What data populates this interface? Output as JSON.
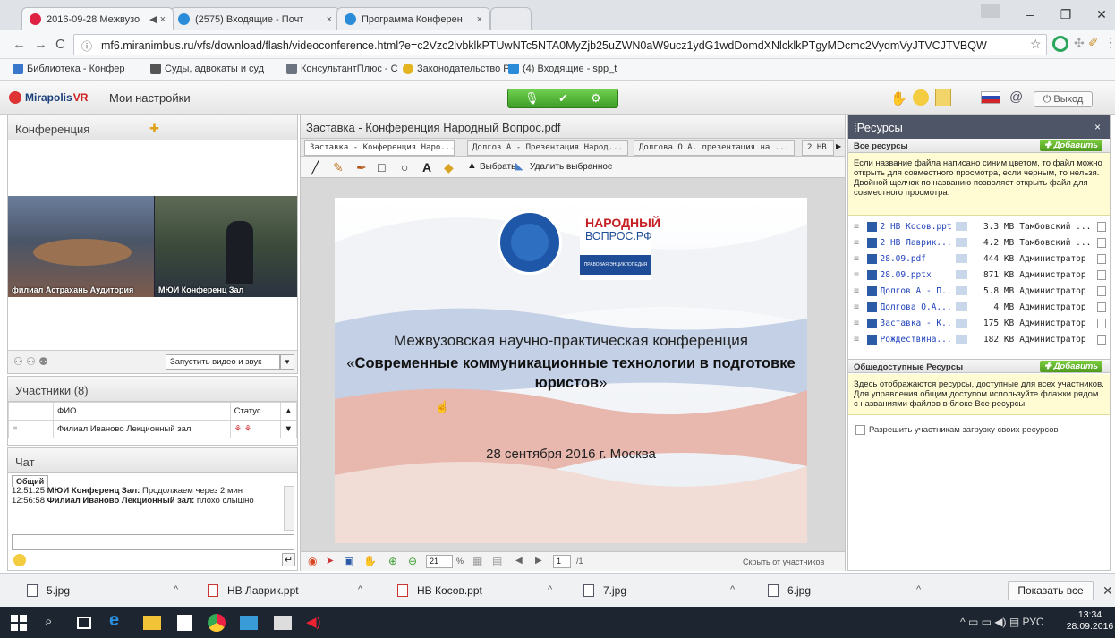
{
  "browser": {
    "tabs": [
      {
        "label": "2016-09-28 Межвузо",
        "active": true
      },
      {
        "label": "(2575) Входящие - Почт"
      },
      {
        "label": "Программа Конферен"
      }
    ],
    "url": "mf6.miranimbus.ru/vfs/download/flash/videoconference.html?e=c2Vzc2lvbklkPTUwNTc5NTA0MyZjb25uZWN0aW9ucz1ydG1wdDomdXNlcklkPTgyMDcmc2VydmVyJTVCJTVBQW",
    "bookmarks": [
      "Библиотека - Конфер",
      "Суды, адвокаты и суд",
      "КонсультантПлюс - С",
      "Законодательство Ро",
      "(4) Входящие - spp_t"
    ]
  },
  "app": {
    "logo_brand": "Mirapolis",
    "logo_suffix": "VR",
    "settings_label": "Мои настройки",
    "exit_label": "Выход"
  },
  "conference": {
    "title": "Конференция",
    "videos": [
      {
        "label": "филиал Астрахань Аудитория"
      },
      {
        "label": "МЮИ Конференц Зал"
      }
    ],
    "start_label": "Запустить видео и звук"
  },
  "participants": {
    "title": "Участники (8)",
    "col_name": "ФИО",
    "col_status": "Статус",
    "rows": [
      {
        "name": "Филиал Иваново Лекционный зал"
      }
    ]
  },
  "chat": {
    "title": "Чат",
    "tab": "Общий",
    "messages": [
      {
        "time": "12:51:25",
        "author": "МЮИ Конференц Зал:",
        "text": "Продолжаем через 2 мин"
      },
      {
        "time": "12:56:58",
        "author": "Филиал Иваново Лекционный зал:",
        "text": "плохо слышно"
      }
    ]
  },
  "presentation": {
    "title": "Заставка - Конференция Народный Вопрос.pdf",
    "doc_tabs": [
      "Заставка - Конференция Наро...",
      "Долгов А - Презентация Народ...",
      "Долгова О.А. презентация на ...",
      "2 НВ"
    ],
    "tools": {
      "select": "Выбрать",
      "delete": "Удалить выбранное"
    },
    "slide": {
      "brand_line1": "НАРОДНЫЙ",
      "brand_line2": "ВОПРОС.РФ",
      "brand_sub": "ПРАВОВАЯ ЭНЦИКЛОПЕДИЯ",
      "line1": "Межвузовская научно-практическая конференция",
      "quote_open": "«",
      "line2": "Современные коммуникационные технологии в подготовке юристов",
      "quote_close": "»",
      "date": "28 сентября 2016 г. Москва"
    },
    "zoom": "21",
    "zoom_unit": "%",
    "page": "1",
    "page_total": "/1",
    "hide_label": "Скрыть от участников"
  },
  "resources": {
    "title": "Ресурсы",
    "all_title": "Все ресурсы",
    "add_label": "Добавить",
    "info": "Если название файла написано синим цветом, то файл можно открыть для совместного просмотра, если черным, то нельзя. Двойной щелчок по названию позволяет открыть файл для совместного просмотра.",
    "files": [
      {
        "name": "2 НВ Косов.ppt",
        "size": "3.3 MB",
        "owner": "Тамбовский ..."
      },
      {
        "name": "2 НВ Лаврик...",
        "size": "4.2 MB",
        "owner": "Тамбовский ..."
      },
      {
        "name": "28.09.pdf",
        "size": "444 KB",
        "owner": "Администратор"
      },
      {
        "name": "28.09.pptx",
        "size": "871 KB",
        "owner": "Администратор"
      },
      {
        "name": "Долгов А - П...",
        "size": "5.8 MB",
        "owner": "Администратор"
      },
      {
        "name": "Долгова О.А...",
        "size": "4 MB",
        "owner": "Администратор"
      },
      {
        "name": "Заставка - К...",
        "size": "175 KB",
        "owner": "Администратор"
      },
      {
        "name": "Рождествина...",
        "size": "182 KB",
        "owner": "Администратор"
      }
    ],
    "public_title": "Общедоступные Ресурсы",
    "public_info": "Здесь отображаются ресурсы, доступные для всех участников. Для управления общим доступом используйте флажки рядом с названиями файлов в блоке Все ресурсы.",
    "allow_upload": "Разрешить участникам загрузку своих ресурсов"
  },
  "downloads": {
    "items": [
      "5.jpg",
      "НВ Лаврик.ppt",
      "НВ Косов.ppt",
      "7.jpg",
      "6.jpg"
    ],
    "show_all": "Показать все"
  },
  "taskbar": {
    "lang": "РУС",
    "time": "13:34",
    "date": "28.09.2016"
  },
  "colors": {
    "accent_green": "#3e9d28",
    "link_blue": "#2244bb",
    "info_yellow": "#fffbd2",
    "resources_header": "#4d5566"
  }
}
